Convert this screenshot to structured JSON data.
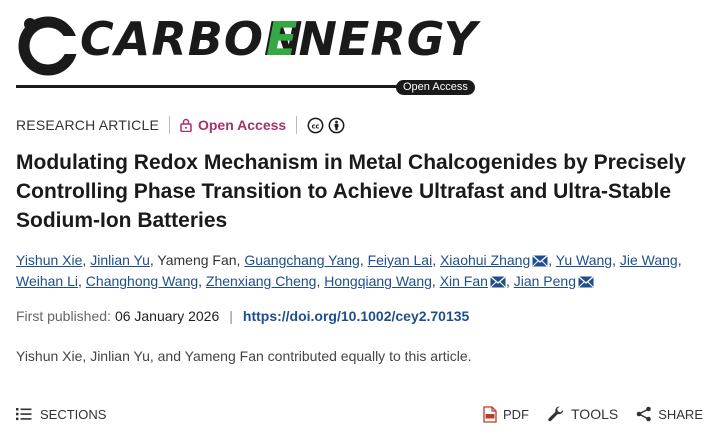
{
  "journal": {
    "name_part1": "CARBON",
    "name_part2_first": "E",
    "name_part2_rest": "NERGY",
    "badge": "Open Access"
  },
  "article_meta": {
    "type": "RESEARCH ARTICLE",
    "access": "Open Access"
  },
  "title": "Modulating Redox Mechanism in Metal Chalcogenides by Precisely Controlling Phase Transition to Achieve Ultrafast and Ultra-Stable Sodium-Ion Batteries",
  "authors": [
    {
      "name": "Yishun Xie",
      "linked": true,
      "corresponding": false
    },
    {
      "name": "Jinlian Yu",
      "linked": true,
      "corresponding": false
    },
    {
      "name": "Yameng Fan",
      "linked": false,
      "corresponding": false
    },
    {
      "name": "Guangchang Yang",
      "linked": true,
      "corresponding": false
    },
    {
      "name": "Feiyan Lai",
      "linked": true,
      "corresponding": false
    },
    {
      "name": "Xiaohui Zhang",
      "linked": true,
      "corresponding": true
    },
    {
      "name": "Yu Wang",
      "linked": true,
      "corresponding": false
    },
    {
      "name": "Jie Wang",
      "linked": true,
      "corresponding": false
    },
    {
      "name": "Weihan Li",
      "linked": true,
      "corresponding": false
    },
    {
      "name": "Changhong Wang",
      "linked": true,
      "corresponding": false
    },
    {
      "name": "Zhenxiang Cheng",
      "linked": true,
      "corresponding": false
    },
    {
      "name": "Hongqiang Wang",
      "linked": true,
      "corresponding": false
    },
    {
      "name": "Xin Fan",
      "linked": true,
      "corresponding": true
    },
    {
      "name": "Jian Peng",
      "linked": true,
      "corresponding": true
    }
  ],
  "publication": {
    "label": "First published:",
    "date": "06 January 2026",
    "separator": "|",
    "doi": "https://doi.org/10.1002/cey2.70135"
  },
  "note": "Yishun Xie, Jinlian Yu, and Yameng Fan contributed equally to this article.",
  "toolbar": {
    "sections_label": "SECTIONS",
    "pdf_label": "PDF",
    "tools_label": "TOOLS",
    "share_label": "SHARE"
  },
  "colors": {
    "link": "#1f4e8c",
    "open_access": "#a4336b",
    "energy_green": "#35a845"
  }
}
